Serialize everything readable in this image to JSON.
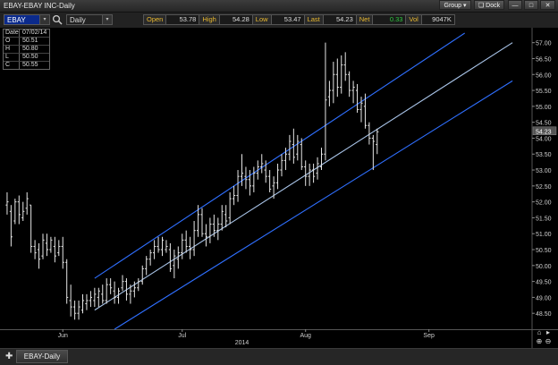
{
  "window": {
    "title": "EBAY-EBAY INC-Daily",
    "group_label": "Group",
    "dock_label": "Dock"
  },
  "toolbar": {
    "symbol": "EBAY",
    "period": "Daily"
  },
  "quote": [
    {
      "label": "Open",
      "value": "53.78"
    },
    {
      "label": "High",
      "value": "54.28"
    },
    {
      "label": "Low",
      "value": "53.47"
    },
    {
      "label": "Last",
      "value": "54.23"
    },
    {
      "label": "Net",
      "value": "0.33"
    },
    {
      "label": "Vol",
      "value": "9047K"
    }
  ],
  "ohlc_box": [
    {
      "k": "Date",
      "v": "07/02/14"
    },
    {
      "k": "O",
      "v": "50.51"
    },
    {
      "k": "H",
      "v": "50.80"
    },
    {
      "k": "L",
      "v": "50.50"
    },
    {
      "k": "C",
      "v": "50.55"
    }
  ],
  "colors": {
    "net_positive": "#2ecc40",
    "channel": "#2f6fff",
    "midline": "#a9c4e8",
    "bars": "#e6e6e6"
  },
  "bottom_tab": "EBAY-Daily",
  "chart_data": {
    "type": "ohlc",
    "y_ticks": [
      "57.00",
      "56.50",
      "56.00",
      "55.50",
      "55.00",
      "54.50",
      "54.00",
      "53.50",
      "53.00",
      "52.50",
      "52.00",
      "51.50",
      "51.00",
      "50.50",
      "50.00",
      "49.50",
      "49.00",
      "48.50"
    ],
    "ylim": [
      48.0,
      57.3
    ],
    "x_labels": [
      {
        "label": "Jun",
        "day": 15
      },
      {
        "label": "Jul",
        "day": 45
      },
      {
        "label": "2014",
        "day": 60,
        "row": 2
      },
      {
        "label": "Aug",
        "day": 76
      },
      {
        "label": "Sep",
        "day": 107
      }
    ],
    "last_price_label": "54.23",
    "last_price": 54.23,
    "channel": {
      "upper": [
        {
          "day": 23,
          "y": 49.6
        },
        {
          "day": 116,
          "y": 57.3
        }
      ],
      "middle": [
        {
          "day": 23,
          "y": 48.6
        },
        {
          "day": 128,
          "y": 57.0
        }
      ],
      "lower": [
        {
          "day": 28,
          "y": 48.0
        },
        {
          "day": 128,
          "y": 55.8
        }
      ]
    },
    "bars": [
      {
        "day": 1,
        "o": 51.9,
        "h": 52.3,
        "l": 51.6,
        "c": 52.0
      },
      {
        "day": 2,
        "o": 51.7,
        "h": 51.9,
        "l": 50.6,
        "c": 50.9
      },
      {
        "day": 3,
        "o": 51.4,
        "h": 52.1,
        "l": 51.3,
        "c": 52.0
      },
      {
        "day": 4,
        "o": 52.0,
        "h": 52.2,
        "l": 51.3,
        "c": 51.6
      },
      {
        "day": 5,
        "o": 51.5,
        "h": 52.0,
        "l": 51.4,
        "c": 51.7
      },
      {
        "day": 6,
        "o": 51.8,
        "h": 52.3,
        "l": 51.6,
        "c": 52.1
      },
      {
        "day": 7,
        "o": 51.9,
        "h": 51.9,
        "l": 50.4,
        "c": 50.6
      },
      {
        "day": 8,
        "o": 50.6,
        "h": 50.8,
        "l": 50.2,
        "c": 50.4
      },
      {
        "day": 9,
        "o": 50.5,
        "h": 50.7,
        "l": 49.9,
        "c": 50.2
      },
      {
        "day": 10,
        "o": 50.3,
        "h": 51.0,
        "l": 50.2,
        "c": 50.8
      },
      {
        "day": 11,
        "o": 50.7,
        "h": 51.0,
        "l": 50.3,
        "c": 50.5
      },
      {
        "day": 12,
        "o": 50.5,
        "h": 50.9,
        "l": 50.4,
        "c": 50.8
      },
      {
        "day": 13,
        "o": 50.6,
        "h": 50.9,
        "l": 50.1,
        "c": 50.3
      },
      {
        "day": 14,
        "o": 50.4,
        "h": 50.8,
        "l": 50.3,
        "c": 50.6
      },
      {
        "day": 15,
        "o": 50.6,
        "h": 50.9,
        "l": 49.9,
        "c": 50.1
      },
      {
        "day": 16,
        "o": 50.1,
        "h": 50.2,
        "l": 48.8,
        "c": 49.0
      },
      {
        "day": 17,
        "o": 48.9,
        "h": 49.4,
        "l": 48.4,
        "c": 48.7
      },
      {
        "day": 18,
        "o": 48.7,
        "h": 48.9,
        "l": 48.3,
        "c": 48.5
      },
      {
        "day": 19,
        "o": 48.5,
        "h": 48.9,
        "l": 48.3,
        "c": 48.7
      },
      {
        "day": 20,
        "o": 48.6,
        "h": 49.1,
        "l": 48.5,
        "c": 48.9
      },
      {
        "day": 21,
        "o": 48.8,
        "h": 49.1,
        "l": 48.6,
        "c": 48.9
      },
      {
        "day": 22,
        "o": 48.9,
        "h": 49.2,
        "l": 48.7,
        "c": 49.0
      },
      {
        "day": 23,
        "o": 48.9,
        "h": 49.3,
        "l": 48.7,
        "c": 49.1
      },
      {
        "day": 24,
        "o": 49.0,
        "h": 49.3,
        "l": 48.7,
        "c": 49.2
      },
      {
        "day": 25,
        "o": 49.1,
        "h": 49.4,
        "l": 48.8,
        "c": 48.9
      },
      {
        "day": 26,
        "o": 48.9,
        "h": 49.6,
        "l": 48.8,
        "c": 49.4
      },
      {
        "day": 27,
        "o": 49.4,
        "h": 49.6,
        "l": 49.1,
        "c": 49.3
      },
      {
        "day": 28,
        "o": 49.2,
        "h": 49.5,
        "l": 48.8,
        "c": 49.0
      },
      {
        "day": 29,
        "o": 49.0,
        "h": 49.3,
        "l": 48.8,
        "c": 49.2
      },
      {
        "day": 30,
        "o": 49.3,
        "h": 49.7,
        "l": 49.2,
        "c": 49.5
      },
      {
        "day": 31,
        "o": 49.5,
        "h": 49.6,
        "l": 48.9,
        "c": 49.1
      },
      {
        "day": 32,
        "o": 49.1,
        "h": 49.4,
        "l": 48.8,
        "c": 49.2
      },
      {
        "day": 33,
        "o": 49.2,
        "h": 49.5,
        "l": 49.0,
        "c": 49.3
      },
      {
        "day": 34,
        "o": 49.3,
        "h": 49.6,
        "l": 49.2,
        "c": 49.5
      },
      {
        "day": 35,
        "o": 49.5,
        "h": 50.0,
        "l": 49.4,
        "c": 49.9
      },
      {
        "day": 36,
        "o": 49.9,
        "h": 50.3,
        "l": 49.7,
        "c": 50.2
      },
      {
        "day": 37,
        "o": 50.2,
        "h": 50.5,
        "l": 50.0,
        "c": 50.4
      },
      {
        "day": 38,
        "o": 50.4,
        "h": 50.8,
        "l": 50.2,
        "c": 50.6
      },
      {
        "day": 39,
        "o": 50.6,
        "h": 50.9,
        "l": 50.4,
        "c": 50.5
      },
      {
        "day": 40,
        "o": 50.5,
        "h": 50.9,
        "l": 50.3,
        "c": 50.8
      },
      {
        "day": 41,
        "o": 50.5,
        "h": 50.8,
        "l": 50.4,
        "c": 50.6
      },
      {
        "day": 42,
        "o": 50.5,
        "h": 50.7,
        "l": 49.8,
        "c": 49.9
      },
      {
        "day": 43,
        "o": 50.0,
        "h": 50.5,
        "l": 49.6,
        "c": 50.3
      },
      {
        "day": 44,
        "o": 50.2,
        "h": 50.6,
        "l": 49.9,
        "c": 50.4
      },
      {
        "day": 45,
        "o": 50.4,
        "h": 51.0,
        "l": 50.2,
        "c": 50.8
      },
      {
        "day": 46,
        "o": 50.8,
        "h": 51.1,
        "l": 50.4,
        "c": 50.6
      },
      {
        "day": 47,
        "o": 50.6,
        "h": 50.9,
        "l": 50.2,
        "c": 50.5
      },
      {
        "day": 48,
        "o": 50.5,
        "h": 51.4,
        "l": 50.3,
        "c": 51.1
      },
      {
        "day": 49,
        "o": 51.1,
        "h": 51.9,
        "l": 50.9,
        "c": 51.6
      },
      {
        "day": 50,
        "o": 51.6,
        "h": 51.8,
        "l": 50.9,
        "c": 51.0
      },
      {
        "day": 51,
        "o": 51.0,
        "h": 51.3,
        "l": 50.6,
        "c": 50.9
      },
      {
        "day": 52,
        "o": 50.9,
        "h": 51.5,
        "l": 50.7,
        "c": 51.3
      },
      {
        "day": 53,
        "o": 51.3,
        "h": 51.6,
        "l": 50.9,
        "c": 51.1
      },
      {
        "day": 54,
        "o": 51.1,
        "h": 51.5,
        "l": 50.8,
        "c": 51.3
      },
      {
        "day": 55,
        "o": 51.3,
        "h": 51.9,
        "l": 51.1,
        "c": 51.7
      },
      {
        "day": 56,
        "o": 51.6,
        "h": 51.9,
        "l": 51.2,
        "c": 51.4
      },
      {
        "day": 57,
        "o": 51.5,
        "h": 52.3,
        "l": 51.3,
        "c": 52.1
      },
      {
        "day": 58,
        "o": 52.1,
        "h": 52.5,
        "l": 51.9,
        "c": 52.2
      },
      {
        "day": 59,
        "o": 52.2,
        "h": 53.0,
        "l": 52.0,
        "c": 52.8
      },
      {
        "day": 60,
        "o": 52.8,
        "h": 53.5,
        "l": 52.5,
        "c": 52.9
      },
      {
        "day": 61,
        "o": 52.8,
        "h": 53.1,
        "l": 52.4,
        "c": 52.7
      },
      {
        "day": 62,
        "o": 52.7,
        "h": 53.0,
        "l": 52.2,
        "c": 52.5
      },
      {
        "day": 63,
        "o": 52.5,
        "h": 53.1,
        "l": 52.3,
        "c": 52.9
      },
      {
        "day": 64,
        "o": 52.9,
        "h": 53.3,
        "l": 52.7,
        "c": 53.1
      },
      {
        "day": 65,
        "o": 53.1,
        "h": 53.5,
        "l": 52.9,
        "c": 53.2
      },
      {
        "day": 66,
        "o": 53.0,
        "h": 53.3,
        "l": 52.6,
        "c": 52.8
      },
      {
        "day": 67,
        "o": 52.8,
        "h": 53.0,
        "l": 52.3,
        "c": 52.4
      },
      {
        "day": 68,
        "o": 52.5,
        "h": 52.8,
        "l": 52.1,
        "c": 52.6
      },
      {
        "day": 69,
        "o": 52.6,
        "h": 53.2,
        "l": 52.4,
        "c": 53.0
      },
      {
        "day": 70,
        "o": 53.0,
        "h": 53.5,
        "l": 52.8,
        "c": 53.3
      },
      {
        "day": 71,
        "o": 53.3,
        "h": 53.7,
        "l": 53.0,
        "c": 53.5
      },
      {
        "day": 72,
        "o": 53.5,
        "h": 54.1,
        "l": 53.3,
        "c": 53.9
      },
      {
        "day": 73,
        "o": 53.8,
        "h": 54.3,
        "l": 53.2,
        "c": 53.4
      },
      {
        "day": 74,
        "o": 53.5,
        "h": 54.1,
        "l": 53.3,
        "c": 53.9
      },
      {
        "day": 75,
        "o": 53.8,
        "h": 54.0,
        "l": 53.0,
        "c": 53.1
      },
      {
        "day": 76,
        "o": 53.1,
        "h": 53.3,
        "l": 52.5,
        "c": 52.8
      },
      {
        "day": 77,
        "o": 52.8,
        "h": 53.2,
        "l": 52.5,
        "c": 53.0
      },
      {
        "day": 78,
        "o": 53.0,
        "h": 53.2,
        "l": 52.6,
        "c": 52.8
      },
      {
        "day": 79,
        "o": 52.9,
        "h": 53.4,
        "l": 52.7,
        "c": 53.2
      },
      {
        "day": 80,
        "o": 53.1,
        "h": 53.7,
        "l": 53.0,
        "c": 53.5
      },
      {
        "day": 81,
        "o": 53.5,
        "h": 57.0,
        "l": 53.3,
        "c": 55.2
      },
      {
        "day": 82,
        "o": 55.3,
        "h": 55.8,
        "l": 55.0,
        "c": 55.5
      },
      {
        "day": 83,
        "o": 55.5,
        "h": 56.4,
        "l": 55.1,
        "c": 56.0
      },
      {
        "day": 84,
        "o": 56.0,
        "h": 56.5,
        "l": 55.3,
        "c": 55.6
      },
      {
        "day": 85,
        "o": 55.6,
        "h": 56.6,
        "l": 55.4,
        "c": 56.3
      },
      {
        "day": 86,
        "o": 56.3,
        "h": 56.7,
        "l": 55.8,
        "c": 56.0
      },
      {
        "day": 87,
        "o": 56.0,
        "h": 56.1,
        "l": 55.3,
        "c": 55.5
      },
      {
        "day": 88,
        "o": 55.5,
        "h": 55.8,
        "l": 55.1,
        "c": 55.6
      },
      {
        "day": 89,
        "o": 55.5,
        "h": 55.7,
        "l": 54.8,
        "c": 54.9
      },
      {
        "day": 90,
        "o": 54.9,
        "h": 55.3,
        "l": 54.5,
        "c": 55.1
      },
      {
        "day": 91,
        "o": 55.0,
        "h": 55.4,
        "l": 54.3,
        "c": 54.4
      },
      {
        "day": 92,
        "o": 54.4,
        "h": 54.5,
        "l": 53.8,
        "c": 54.0
      },
      {
        "day": 93,
        "o": 54.0,
        "h": 54.1,
        "l": 53.0,
        "c": 53.9
      },
      {
        "day": 94,
        "o": 53.8,
        "h": 54.3,
        "l": 53.5,
        "c": 54.2
      }
    ]
  }
}
